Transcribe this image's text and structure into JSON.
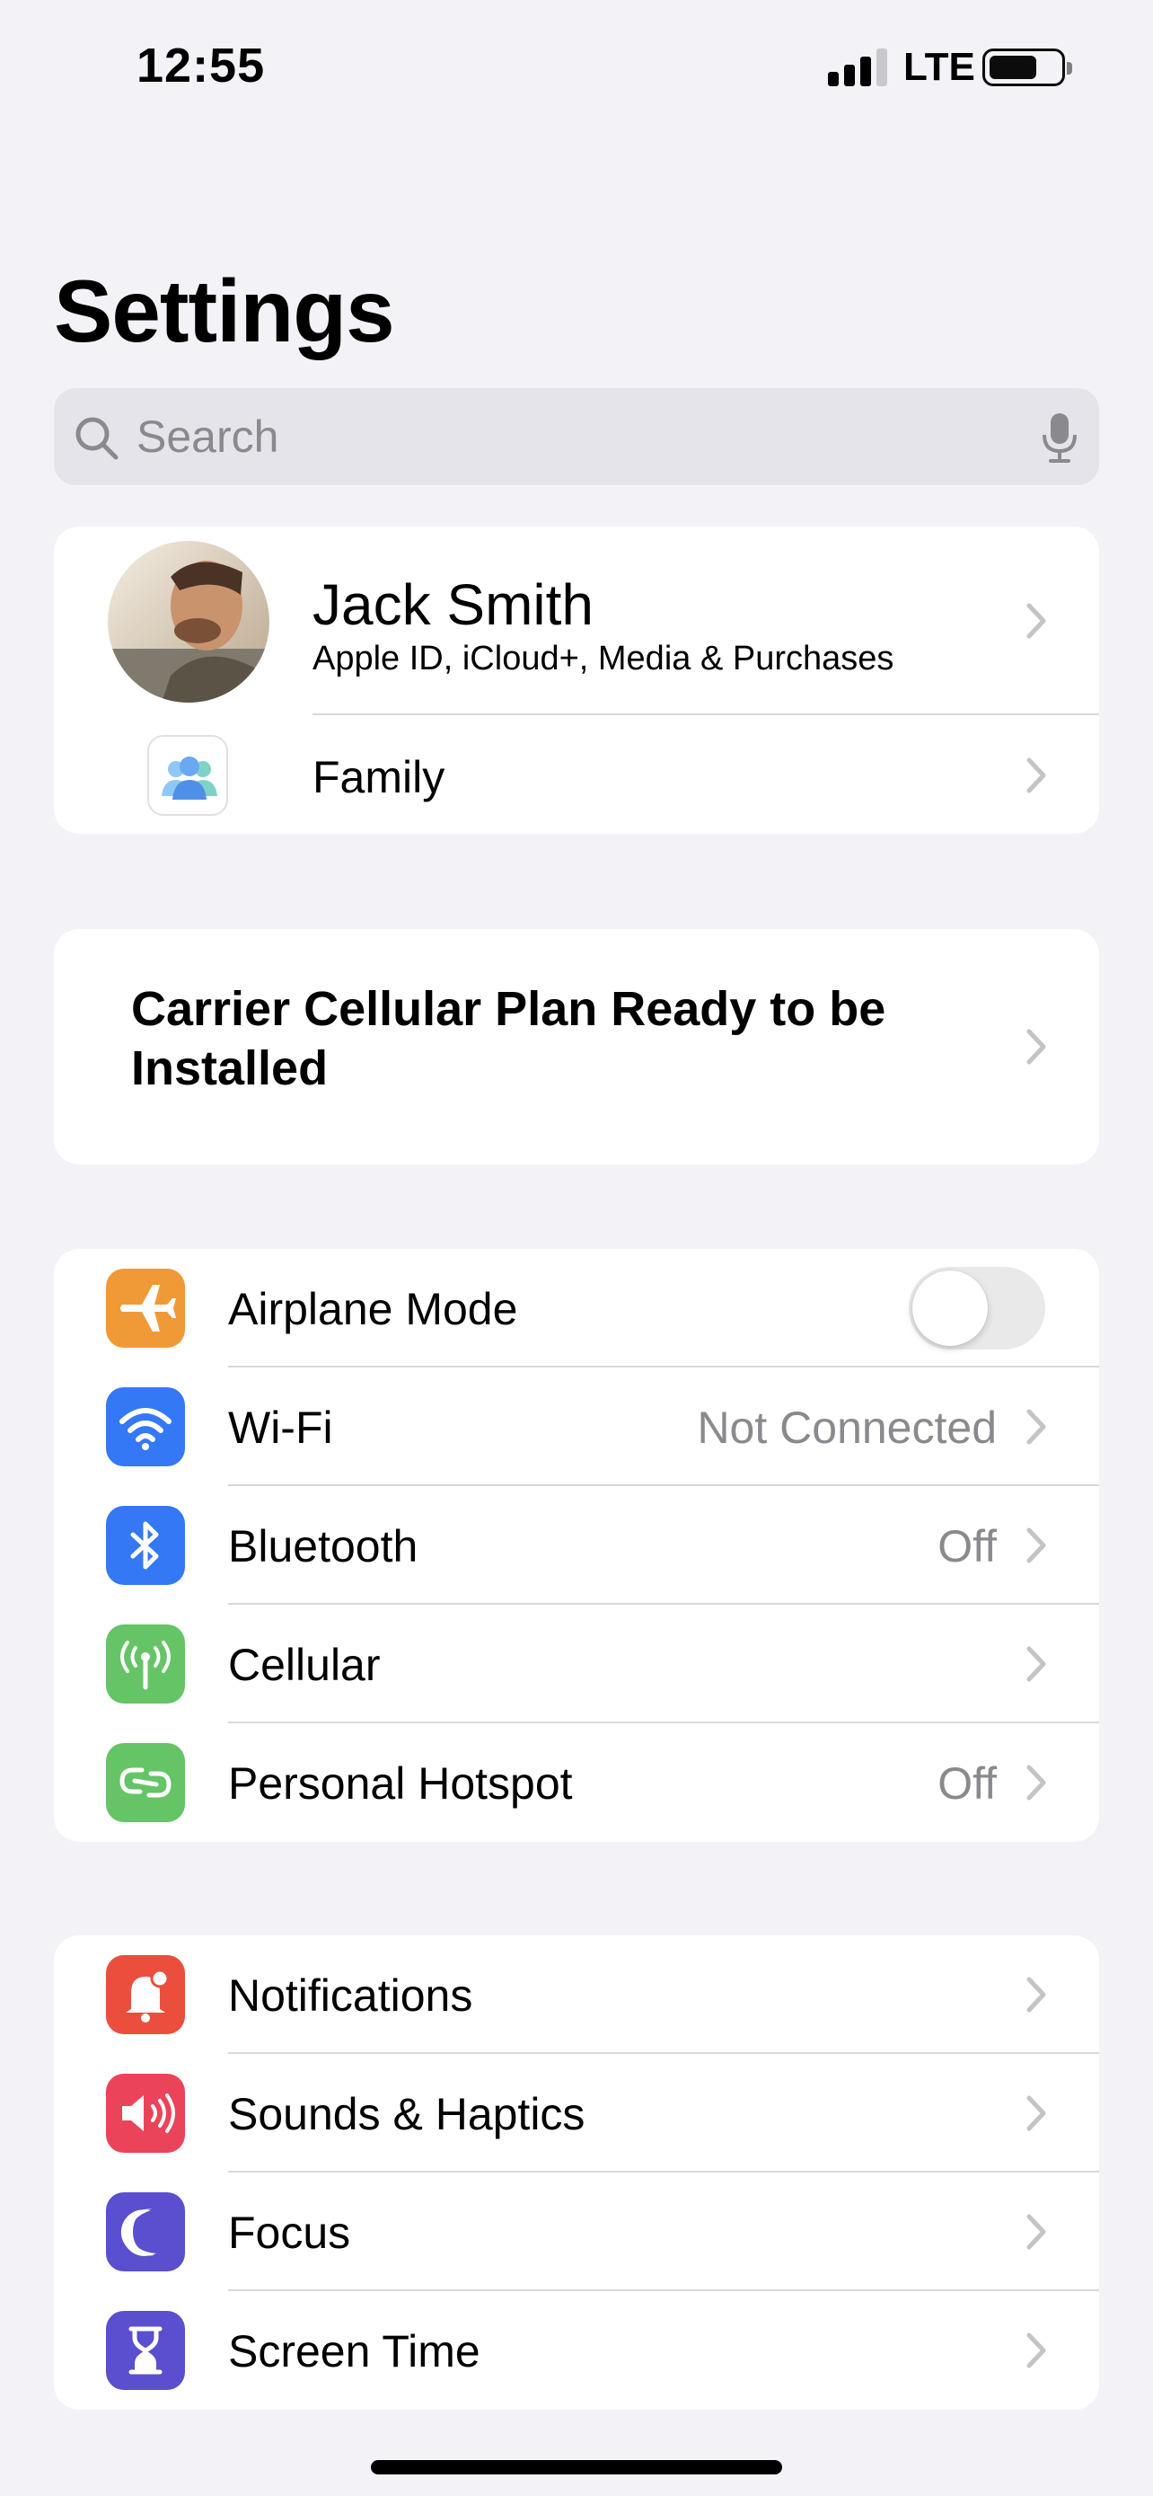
{
  "status_bar": {
    "time": "12:55",
    "network": "LTE",
    "signal_bars": 3,
    "battery_level": 0.7
  },
  "title": "Settings",
  "search": {
    "placeholder": "Search",
    "value": ""
  },
  "profile": {
    "name": "Jack Smith",
    "subtitle": "Apple ID, iCloud+, Media & Purchases",
    "family_label": "Family"
  },
  "carrier_banner": {
    "text": "Carrier Cellular Plan Ready to be Installed"
  },
  "connectivity": {
    "airplane_mode": {
      "label": "Airplane Mode",
      "on": false,
      "icon": "airplane-icon",
      "color": "#f09a37"
    },
    "wifi": {
      "label": "Wi-Fi",
      "value": "Not Connected",
      "icon": "wifi-icon",
      "color": "#3478f6"
    },
    "bluetooth": {
      "label": "Bluetooth",
      "value": "Off",
      "icon": "bluetooth-icon",
      "color": "#3478f6"
    },
    "cellular": {
      "label": "Cellular",
      "value": "",
      "icon": "cellular-antenna-icon",
      "color": "#65c466"
    },
    "hotspot": {
      "label": "Personal Hotspot",
      "value": "Off",
      "icon": "hotspot-icon",
      "color": "#65c466"
    }
  },
  "general": {
    "notifications": {
      "label": "Notifications",
      "icon": "bell-icon",
      "color": "#eb4e3d"
    },
    "sounds": {
      "label": "Sounds & Haptics",
      "icon": "speaker-icon",
      "color": "#eb445a"
    },
    "focus": {
      "label": "Focus",
      "icon": "moon-icon",
      "color": "#5a4fcf"
    },
    "screen_time": {
      "label": "Screen Time",
      "icon": "hourglass-icon",
      "color": "#5a4fcf"
    }
  }
}
